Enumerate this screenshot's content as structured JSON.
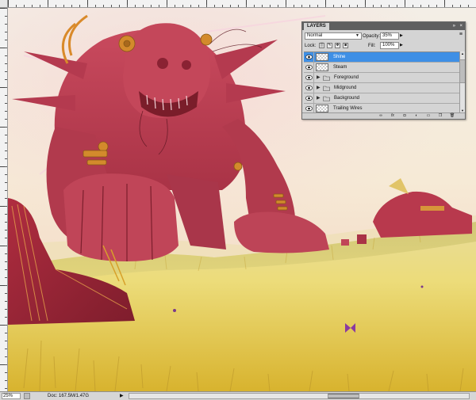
{
  "layers_panel": {
    "title": "LAYERS",
    "blend_mode": "Normal",
    "opacity_label": "Opacity:",
    "opacity_value": "35%",
    "lock_label": "Lock:",
    "fill_label": "Fill:",
    "fill_value": "100%",
    "layers": [
      {
        "name": "Shine",
        "kind": "pixel",
        "visible": true,
        "selected": true
      },
      {
        "name": "Steam",
        "kind": "pixel",
        "visible": true,
        "selected": false
      },
      {
        "name": "Foreground",
        "kind": "group",
        "visible": true,
        "selected": false
      },
      {
        "name": "Midground",
        "kind": "group",
        "visible": true,
        "selected": false
      },
      {
        "name": "Background",
        "kind": "group",
        "visible": true,
        "selected": false
      },
      {
        "name": "Trailing Wires",
        "kind": "pixel",
        "visible": true,
        "selected": false
      }
    ],
    "footer_icons": [
      "link-icon",
      "fx-icon",
      "mask-icon",
      "adjustment-icon",
      "folder-icon",
      "new-layer-icon",
      "trash-icon"
    ]
  },
  "status_bar": {
    "zoom": "25%",
    "doc_info": "Doc: 167.5M/1.47G"
  },
  "colors": {
    "selection_blue": "#3e8fe5",
    "panel_gray": "#d4d4d4",
    "robot_red": "#b8384c",
    "grass_yellow": "#e6d36a",
    "sky": "#f2e9d0"
  }
}
